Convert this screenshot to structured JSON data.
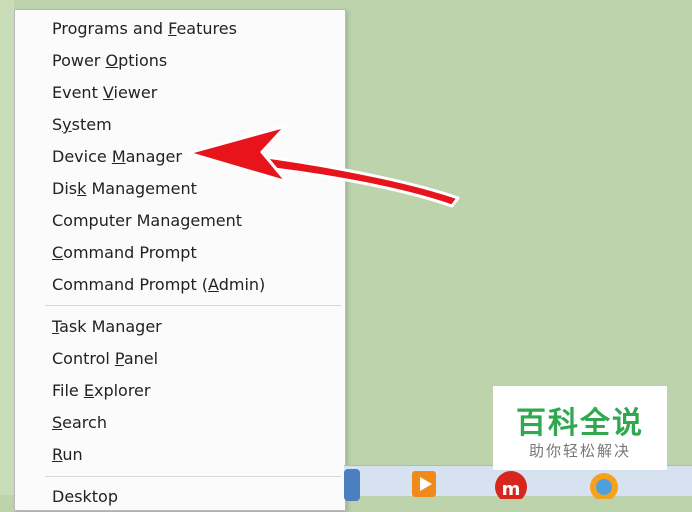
{
  "menu": {
    "group1": [
      {
        "pre": "Programs and ",
        "key": "F",
        "post": "eatures"
      },
      {
        "pre": "Power ",
        "key": "O",
        "post": "ptions"
      },
      {
        "pre": "Event ",
        "key": "V",
        "post": "iewer"
      },
      {
        "pre": "S",
        "key": "y",
        "post": "stem"
      },
      {
        "pre": "Device ",
        "key": "M",
        "post": "anager"
      },
      {
        "pre": "Dis",
        "key": "k",
        "post": " Management"
      },
      {
        "pre": "Computer Mana",
        "key": "g",
        "post": "ement"
      },
      {
        "pre": "",
        "key": "C",
        "post": "ommand Prompt"
      },
      {
        "pre": "Command Prompt (",
        "key": "A",
        "post": "dmin)"
      }
    ],
    "group2": [
      {
        "pre": "",
        "key": "T",
        "post": "ask Manager"
      },
      {
        "pre": "Control ",
        "key": "P",
        "post": "anel"
      },
      {
        "pre": "File ",
        "key": "E",
        "post": "xplorer"
      },
      {
        "pre": "",
        "key": "S",
        "post": "earch"
      },
      {
        "pre": "",
        "key": "R",
        "post": "un"
      }
    ],
    "group3": [
      {
        "pre": "",
        "key": "",
        "post": "Desktop"
      }
    ]
  },
  "watermark": {
    "title": "百科全说",
    "subtitle": "助你轻松解决"
  },
  "colors": {
    "desktop": "#bdd3ac",
    "arrow": "#e8141c",
    "watermark_green": "#2fa84f"
  },
  "taskbar": {
    "icons": [
      "media-player-icon",
      "app-m-icon",
      "refresh-icon"
    ]
  }
}
